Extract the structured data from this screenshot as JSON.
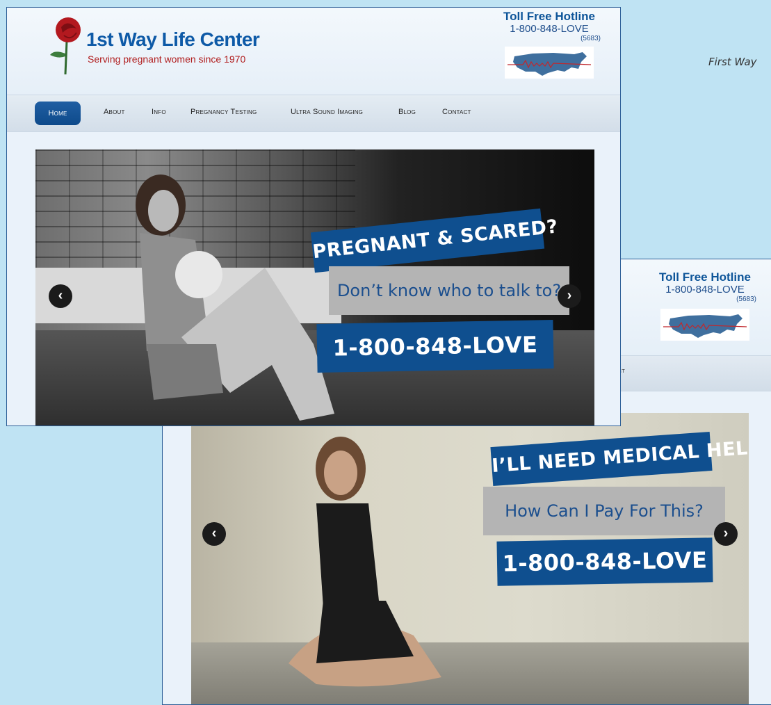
{
  "caption": "First Way",
  "site": {
    "title": "1st Way Life Center",
    "subtitle": "Serving pregnant women since 1970",
    "hotline": {
      "title": "Toll Free Hotline",
      "number": "1-800-848-LOVE",
      "digits": "(5683)"
    },
    "nav": [
      "Home",
      "About",
      "Info",
      "Pregnancy Testing",
      "Ultra Sound Imaging",
      "Blog",
      "Contact"
    ],
    "active_nav": "Home"
  },
  "back_nav_fragment": "ct",
  "slides": [
    {
      "headline": "PREGNANT & SCARED?",
      "question": "Don’t know who to talk to?",
      "phone": "1-800-848-LOVE"
    },
    {
      "headline": "I’LL NEED MEDICAL HELP",
      "question": "How Can I Pay For This?",
      "phone": "1-800-848-LOVE"
    }
  ],
  "icons": {
    "prev": "chevron-left-icon",
    "next": "chevron-right-icon",
    "logo": "rose-icon",
    "map": "us-map-icon"
  },
  "colors": {
    "brand_blue": "#0f4f8f",
    "rose_red": "#b01d1d",
    "page_bg": "#bfe3f3"
  }
}
